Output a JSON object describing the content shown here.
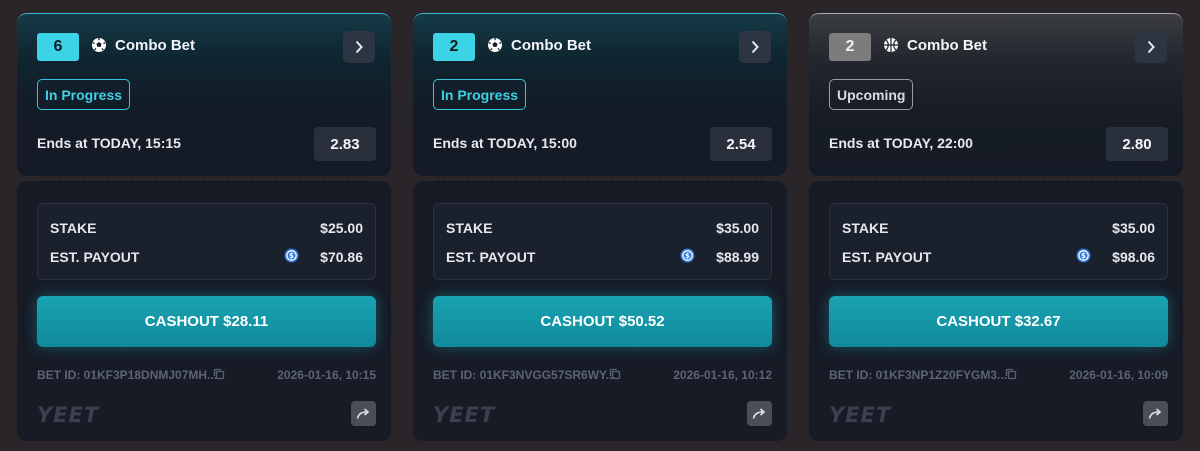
{
  "cards": [
    {
      "count": "6",
      "sport_icon": "soccer-ball-icon",
      "title": "Combo Bet",
      "status": "In Progress",
      "ends": "Ends at TODAY, 15:15",
      "odds": "2.83",
      "stake_label": "STAKE",
      "stake_value": "$25.00",
      "payout_label": "EST. PAYOUT",
      "payout_value": "$70.86",
      "cashout": "CASHOUT $28.11",
      "bet_id": "BET ID: 01KF3P18DNMJ07MH...",
      "date": "2026-01-16, 10:15",
      "logo": "YEET"
    },
    {
      "count": "2",
      "sport_icon": "soccer-ball-icon",
      "title": "Combo Bet",
      "status": "In Progress",
      "ends": "Ends at TODAY, 15:00",
      "odds": "2.54",
      "stake_label": "STAKE",
      "stake_value": "$35.00",
      "payout_label": "EST. PAYOUT",
      "payout_value": "$88.99",
      "cashout": "CASHOUT $50.52",
      "bet_id": "BET ID: 01KF3NVGG57SR6WY...",
      "date": "2026-01-16, 10:12",
      "logo": "YEET"
    },
    {
      "count": "2",
      "sport_icon": "basketball-icon",
      "title": "Combo Bet",
      "status": "Upcoming",
      "ends": "Ends at TODAY, 22:00",
      "odds": "2.80",
      "stake_label": "STAKE",
      "stake_value": "$35.00",
      "payout_label": "EST. PAYOUT",
      "payout_value": "$98.06",
      "cashout": "CASHOUT $32.67",
      "bet_id": "BET ID: 01KF3NP1Z20FYGM3...",
      "date": "2026-01-16, 10:09",
      "logo": "YEET"
    }
  ],
  "colors": {
    "accent": "#3dd3e6",
    "cashout": "#1296a6",
    "upcoming": "#7c7c7c",
    "background": "#2a2528"
  },
  "icons": {
    "nav": "chevron-right-icon",
    "coin": "usdc-coin-icon",
    "copy": "copy-icon",
    "share": "share-icon"
  }
}
